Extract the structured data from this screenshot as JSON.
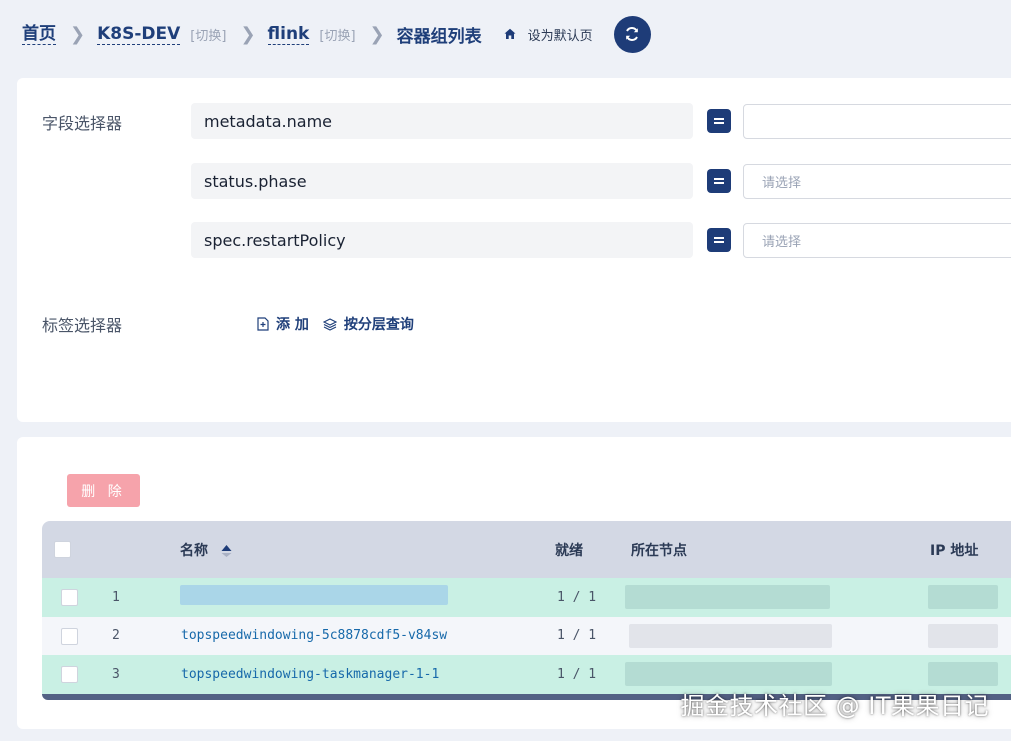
{
  "breadcrumb": {
    "home": "首页",
    "cluster": "K8S-DEV",
    "cluster_switch": "[切换]",
    "namespace": "flink",
    "namespace_switch": "[切换]",
    "current": "容器组列表",
    "set_default": "设为默认页"
  },
  "filters": {
    "field_label": "字段选择器",
    "fields": [
      {
        "name": "metadata.name",
        "value": "",
        "placeholder": ""
      },
      {
        "name": "status.phase",
        "value": "",
        "placeholder": "请选择"
      },
      {
        "name": "spec.restartPolicy",
        "value": "",
        "placeholder": "请选择"
      }
    ],
    "operator": "=",
    "tag_label": "标签选择器",
    "add_label": "添 加",
    "layer_query_label": "按分层查询"
  },
  "table": {
    "delete_label": "删 除",
    "columns": [
      "名称",
      "就绪",
      "所在节点",
      "IP 地址"
    ],
    "rows": [
      {
        "index": "1",
        "name": "",
        "ready": "1 / 1"
      },
      {
        "index": "2",
        "name": "topspeedwindowing-5c8878cdf5-v84sw",
        "ready": "1 / 1"
      },
      {
        "index": "3",
        "name": "topspeedwindowing-taskmanager-1-1",
        "ready": "1 / 1"
      }
    ]
  },
  "watermark": "掘金技术社区 @ IT果果日记",
  "colors": {
    "primary": "#1e3c78",
    "row_highlight": "#c9f0e4",
    "delete_disabled": "#f6a3ab",
    "link": "#1769aa"
  }
}
